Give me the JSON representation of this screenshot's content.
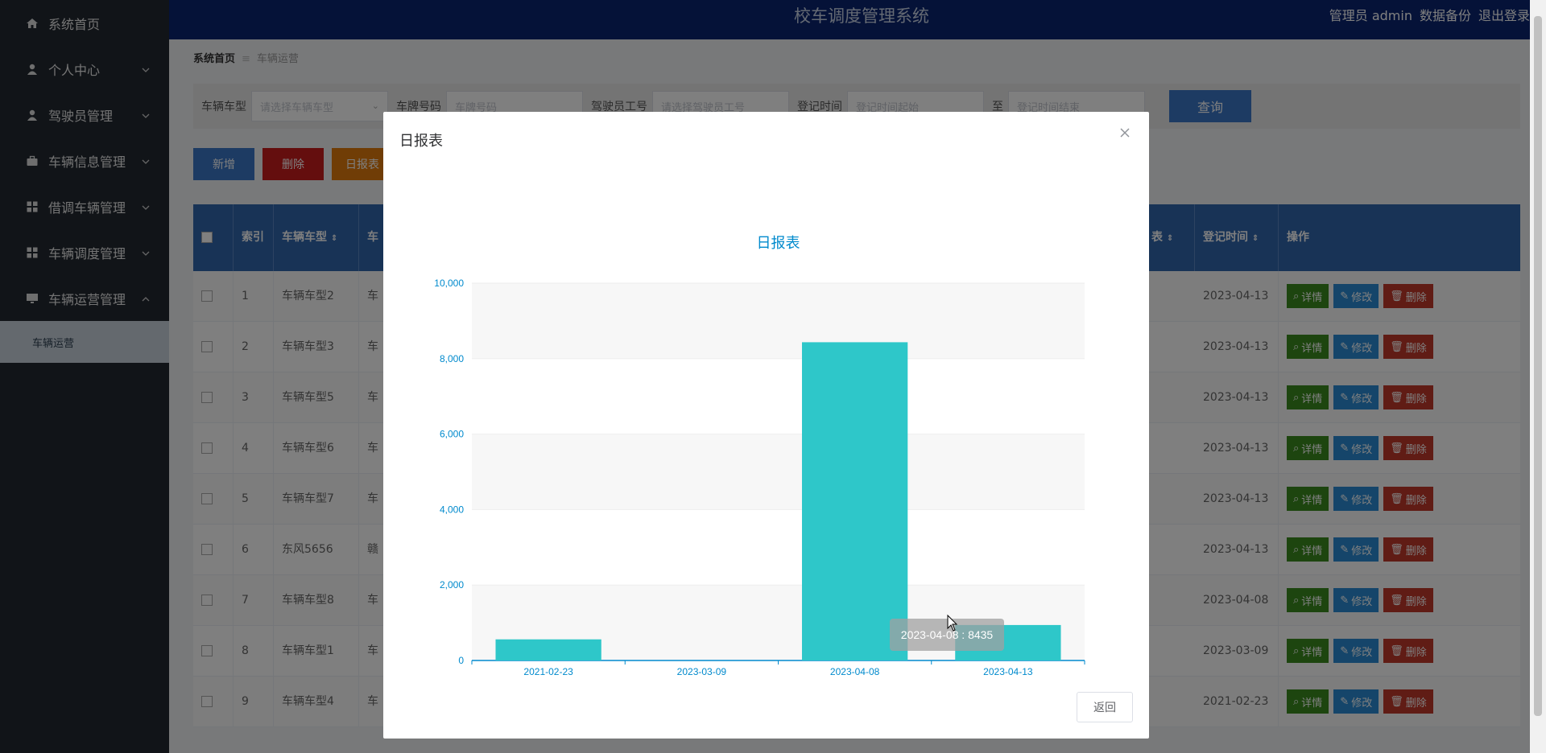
{
  "header": {
    "title": "校车调度管理系统",
    "user": "管理员 admin",
    "backup": "数据备份",
    "logout": "退出登录"
  },
  "sidebar": {
    "items": [
      {
        "label": "系统首页",
        "icon": "home-icon",
        "chevron": ""
      },
      {
        "label": "个人中心",
        "icon": "user-icon",
        "chevron": "down"
      },
      {
        "label": "驾驶员管理",
        "icon": "user-icon",
        "chevron": "down"
      },
      {
        "label": "车辆信息管理",
        "icon": "briefcase-icon",
        "chevron": "down"
      },
      {
        "label": "借调车辆管理",
        "icon": "grid-icon",
        "chevron": "down"
      },
      {
        "label": "车辆调度管理",
        "icon": "grid-icon",
        "chevron": "down"
      },
      {
        "label": "车辆运营管理",
        "icon": "monitor-icon",
        "chevron": "up"
      }
    ],
    "subitem": "车辆运营"
  },
  "breadcrumb": {
    "home": "系统首页",
    "current": "车辆运营"
  },
  "search": {
    "vehicle_type_label": "车辆车型",
    "vehicle_type_placeholder": "请选择车辆车型",
    "plate_label": "车牌号码",
    "plate_placeholder": "车牌号码",
    "driver_label": "驾驶员工号",
    "driver_placeholder": "请选择驾驶员工号",
    "date_label": "登记时间",
    "date_start_placeholder": "登记时间起始",
    "date_to": "至",
    "date_end_placeholder": "登记时间结束",
    "query_label": "查询"
  },
  "actions": {
    "add": "新增",
    "delete": "删除",
    "daily": "日报表"
  },
  "table": {
    "headers": {
      "index": "索引",
      "vehicle_type": "车辆车型",
      "vehicle_prefix": "车",
      "tail_suffix": "表",
      "reg_time": "登记时间",
      "ops": "操作"
    },
    "rows": [
      {
        "index": "1",
        "type": "车辆车型2",
        "plate": "车",
        "date": "2023-04-13"
      },
      {
        "index": "2",
        "type": "车辆车型3",
        "plate": "车",
        "date": "2023-04-13"
      },
      {
        "index": "3",
        "type": "车辆车型5",
        "plate": "车",
        "date": "2023-04-13"
      },
      {
        "index": "4",
        "type": "车辆车型6",
        "plate": "车",
        "date": "2023-04-13"
      },
      {
        "index": "5",
        "type": "车辆车型7",
        "plate": "车",
        "date": "2023-04-13"
      },
      {
        "index": "6",
        "type": "东风5656",
        "plate": "赣",
        "date": "2023-04-13"
      },
      {
        "index": "7",
        "type": "车辆车型8",
        "plate": "车",
        "date": "2023-04-08"
      },
      {
        "index": "8",
        "type": "车辆车型1",
        "plate": "车",
        "date": "2023-03-09"
      },
      {
        "index": "9",
        "type": "车辆车型4",
        "plate": "车",
        "date": "2021-02-23"
      }
    ],
    "op_labels": {
      "detail": "详情",
      "edit": "修改",
      "delete": "删除"
    }
  },
  "modal": {
    "title": "日报表",
    "back_label": "返回"
  },
  "colors": {
    "bar": "#2ec7c9",
    "axis_text": "#008acd",
    "title": "#008acd",
    "sidebar_bg": "#222831",
    "header_bg": "#0a2570",
    "btn_green": "#3a8a1f",
    "btn_blue": "#2a8bd4",
    "btn_red": "#c0392b"
  },
  "chart_data": {
    "type": "bar",
    "title": "日报表",
    "categories": [
      "2021-02-23",
      "2023-03-09",
      "2023-04-08",
      "2023-04-13"
    ],
    "values": [
      560,
      0,
      8435,
      940
    ],
    "ylim": [
      0,
      10000
    ],
    "yticks": [
      0,
      2000,
      4000,
      6000,
      8000,
      10000
    ],
    "ytick_labels": [
      "0",
      "2,000",
      "4,000",
      "6,000",
      "8,000",
      "10,000"
    ],
    "xlabel": "",
    "ylabel": "",
    "tooltip": "2023-04-08 : 8435"
  }
}
